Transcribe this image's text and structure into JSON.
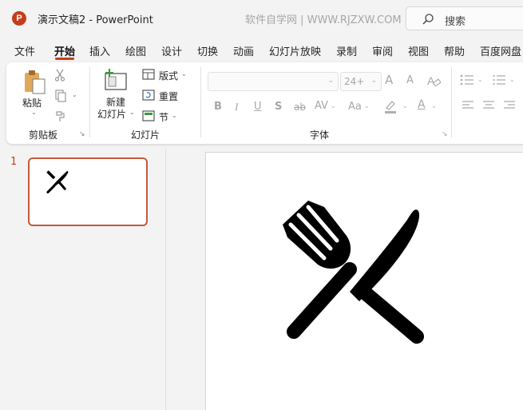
{
  "titlebar": {
    "app_logo": "P",
    "doc_title": "演示文稿2  -  PowerPoint",
    "watermark": "软件自学网 | WWW.RJZXW.COM",
    "search_label": "搜索"
  },
  "tabs": {
    "file": "文件",
    "home": "开始",
    "insert": "插入",
    "draw": "绘图",
    "design": "设计",
    "transitions": "切换",
    "animations": "动画",
    "slideshow": "幻灯片放映",
    "record": "录制",
    "review": "审阅",
    "view": "视图",
    "help": "帮助",
    "baidu": "百度网盘"
  },
  "ribbon": {
    "paste": "粘贴",
    "clipboard_group": "剪贴板",
    "new_slide_line1": "新建",
    "new_slide_line2": "幻灯片",
    "layout": "版式",
    "reset": "重置",
    "section": "节",
    "slides_group": "幻灯片",
    "font_name": "",
    "font_size": "24+",
    "bold": "B",
    "italic": "I",
    "underline": "U",
    "shadow": "S",
    "strike": "ab",
    "char_spacing": "AV",
    "change_case": "Aa",
    "font_color": "A",
    "grow_font": "A",
    "shrink_font": "A",
    "font_group": "字体"
  },
  "slides_panel": {
    "slide_number": "1"
  },
  "colors": {
    "accent": "#c43e1c",
    "thumb_border": "#c4593c",
    "icon_black": "#000000"
  }
}
